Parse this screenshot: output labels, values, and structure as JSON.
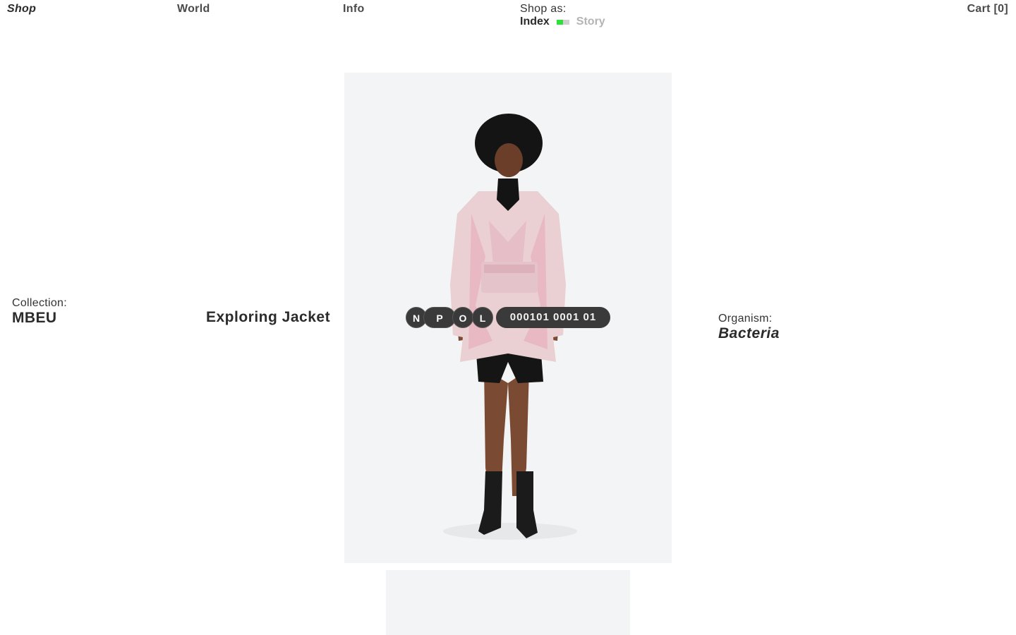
{
  "nav": {
    "shop": "Shop",
    "world": "World",
    "info": "Info",
    "cart": "Cart [0]"
  },
  "shop_as": {
    "label": "Shop as:",
    "index": "Index",
    "story": "Story",
    "selected": "Index",
    "toggle_color": "#2fe03a"
  },
  "collection": {
    "label": "Collection:",
    "value": "MBEU"
  },
  "product": {
    "name": "Exploring Jacket",
    "tags": [
      "N",
      "P",
      "O",
      "L"
    ],
    "code": "000101 0001 01"
  },
  "organism": {
    "label": "Organism:",
    "value": "Bacteria"
  }
}
